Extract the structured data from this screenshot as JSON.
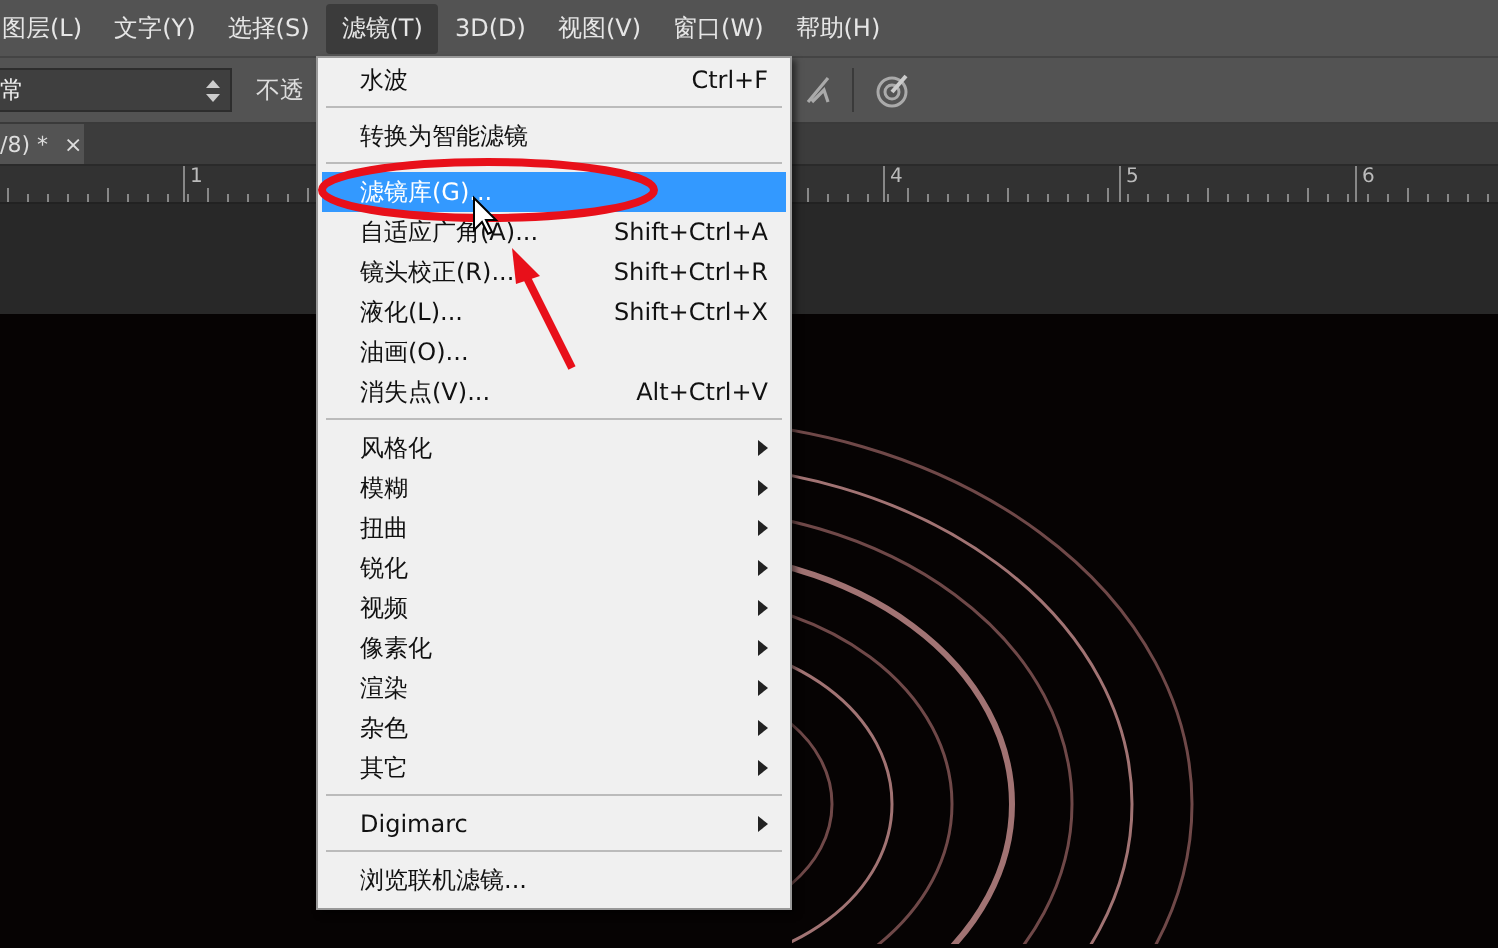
{
  "menu_bar": [
    {
      "label": "图层(L)",
      "selected": false
    },
    {
      "label": "文字(Y)",
      "selected": false
    },
    {
      "label": "选择(S)",
      "selected": false
    },
    {
      "label": "滤镜(T)",
      "selected": true
    },
    {
      "label": "3D(D)",
      "selected": false
    },
    {
      "label": "视图(V)",
      "selected": false
    },
    {
      "label": "窗口(W)",
      "selected": false
    },
    {
      "label": "帮助(H)",
      "selected": false
    }
  ],
  "options_bar": {
    "mode_select": "常",
    "opacity_label": "不透"
  },
  "document_tab": {
    "title": "/8) *",
    "close": "×"
  },
  "ruler": {
    "labels": [
      "1",
      "4",
      "5",
      "6"
    ]
  },
  "filter_menu": {
    "items": [
      {
        "kind": "item",
        "label": "水波",
        "shortcut": "Ctrl+F",
        "selected": false
      },
      {
        "kind": "separator"
      },
      {
        "kind": "item",
        "label": "转换为智能滤镜",
        "selected": false
      },
      {
        "kind": "separator"
      },
      {
        "kind": "item",
        "label": "滤镜库(G)...",
        "selected": true
      },
      {
        "kind": "item",
        "label": "自适应广角(A)...",
        "shortcut": "Shift+Ctrl+A",
        "selected": false
      },
      {
        "kind": "item",
        "label": "镜头校正(R)...",
        "shortcut": "Shift+Ctrl+R",
        "selected": false
      },
      {
        "kind": "item",
        "label": "液化(L)...",
        "shortcut": "Shift+Ctrl+X",
        "selected": false
      },
      {
        "kind": "item",
        "label": "油画(O)...",
        "selected": false
      },
      {
        "kind": "item",
        "label": "消失点(V)...",
        "shortcut": "Alt+Ctrl+V",
        "selected": false
      },
      {
        "kind": "separator"
      },
      {
        "kind": "submenu",
        "label": "风格化",
        "selected": false
      },
      {
        "kind": "submenu",
        "label": "模糊",
        "selected": false
      },
      {
        "kind": "submenu",
        "label": "扭曲",
        "selected": false
      },
      {
        "kind": "submenu",
        "label": "锐化",
        "selected": false
      },
      {
        "kind": "submenu",
        "label": "视频",
        "selected": false
      },
      {
        "kind": "submenu",
        "label": "像素化",
        "selected": false
      },
      {
        "kind": "submenu",
        "label": "渲染",
        "selected": false
      },
      {
        "kind": "submenu",
        "label": "杂色",
        "selected": false
      },
      {
        "kind": "submenu",
        "label": "其它",
        "selected": false
      },
      {
        "kind": "separator"
      },
      {
        "kind": "submenu",
        "label": "Digimarc",
        "selected": false
      },
      {
        "kind": "separator"
      },
      {
        "kind": "item",
        "label": "浏览联机滤镜...",
        "selected": false
      }
    ]
  }
}
